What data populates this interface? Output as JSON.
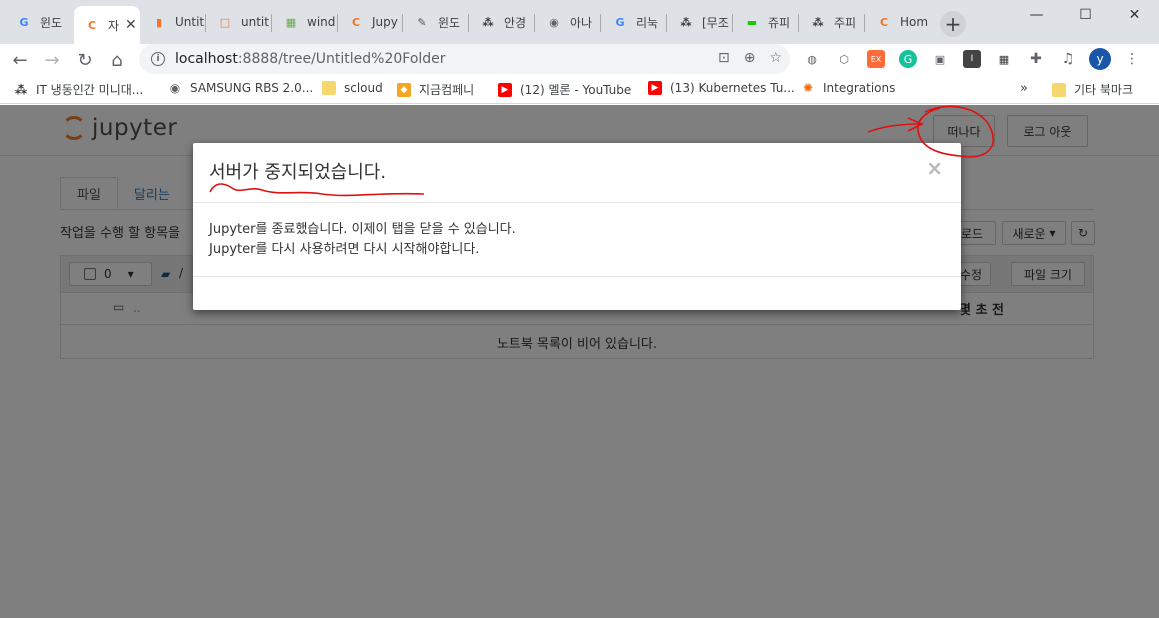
{
  "browser": {
    "tabs": [
      {
        "label": "윈도",
        "icon": "google-icon",
        "color": "#4285f4",
        "glyph": "G"
      },
      {
        "label": "자",
        "icon": "jupyter-icon",
        "color": "#f37726",
        "glyph": "C",
        "active": true
      },
      {
        "label": "Untit",
        "icon": "book-icon",
        "color": "#f37726",
        "glyph": "▮"
      },
      {
        "label": "untit",
        "icon": "file-icon",
        "color": "#f37726",
        "glyph": "□"
      },
      {
        "label": "wind",
        "icon": "grid-icon",
        "color": "#6aa84f",
        "glyph": "▦"
      },
      {
        "label": "Jupy",
        "icon": "jupyter-icon",
        "color": "#f37726",
        "glyph": "C"
      },
      {
        "label": "윈도",
        "icon": "pen-icon",
        "color": "#555555",
        "glyph": "✎"
      },
      {
        "label": "안경",
        "icon": "tree-icon",
        "color": "#333333",
        "glyph": "⁂"
      },
      {
        "label": "아나",
        "icon": "globe-icon",
        "color": "#5f6368",
        "glyph": "◉"
      },
      {
        "label": "리눅",
        "icon": "google-icon",
        "color": "#4285f4",
        "glyph": "G"
      },
      {
        "label": "[무조",
        "icon": "tree-icon",
        "color": "#333333",
        "glyph": "⁂"
      },
      {
        "label": "쥬피",
        "icon": "chat-icon",
        "color": "#1ec800",
        "glyph": "▬"
      },
      {
        "label": "주피",
        "icon": "tree-icon",
        "color": "#333333",
        "glyph": "⁂"
      },
      {
        "label": "Hom",
        "icon": "jupyter-icon",
        "color": "#f37726",
        "glyph": "C"
      }
    ],
    "url_host": "localhost",
    "url_path": ":8888/tree/Untitled%20Folder",
    "profile_initial": "y",
    "bookmarks": [
      {
        "label": "IT 냉동인간 미니대...",
        "icon": "tree-icon",
        "color": "#333333"
      },
      {
        "label": "SAMSUNG RBS 2.0...",
        "icon": "globe-icon",
        "color": "#5f6368"
      },
      {
        "label": "scloud",
        "icon": "folder-icon",
        "color": "#f5d76e"
      },
      {
        "label": "지금컴페니",
        "icon": "cube-icon",
        "color": "#f5a623"
      },
      {
        "label": "(12) 멜론 - YouTube",
        "icon": "youtube-icon",
        "color": "#ff0000"
      },
      {
        "label": "(13) Kubernetes Tu...",
        "icon": "youtube-icon",
        "color": "#ff0000"
      },
      {
        "label": "Integrations",
        "icon": "grafana-icon",
        "color": "#f46800"
      }
    ],
    "bookmarks_more": "»",
    "other_bookmarks": "기타 북마크"
  },
  "jupyter": {
    "logo_text": "jupyter",
    "quit_label": "떠나다",
    "logout_label": "로그 아웃",
    "tabs": [
      "파일",
      "달리는"
    ],
    "instruction": "작업을 수행 할 항목을",
    "upload_label": "로드",
    "new_label": "새로운",
    "select_count": "0",
    "edit_label": "수정",
    "filesize_label": "파일 크기",
    "modified_label": "몇 초 전",
    "parent_dir": "..",
    "path_sep": "/",
    "empty_message": "노트북 목록이 비어 있습니다."
  },
  "modal": {
    "title": "서버가 중지되었습니다.",
    "close": "×",
    "line1": "Jupyter를 종료했습니다. 이제이 탭을 닫을 수 있습니다.",
    "line2": "Jupyter를 다시 사용하려면 다시 시작해야합니다."
  },
  "colors": {
    "jupyter_orange": "#f37726",
    "annotation_red": "#e01010",
    "link_blue": "#337ab7"
  }
}
